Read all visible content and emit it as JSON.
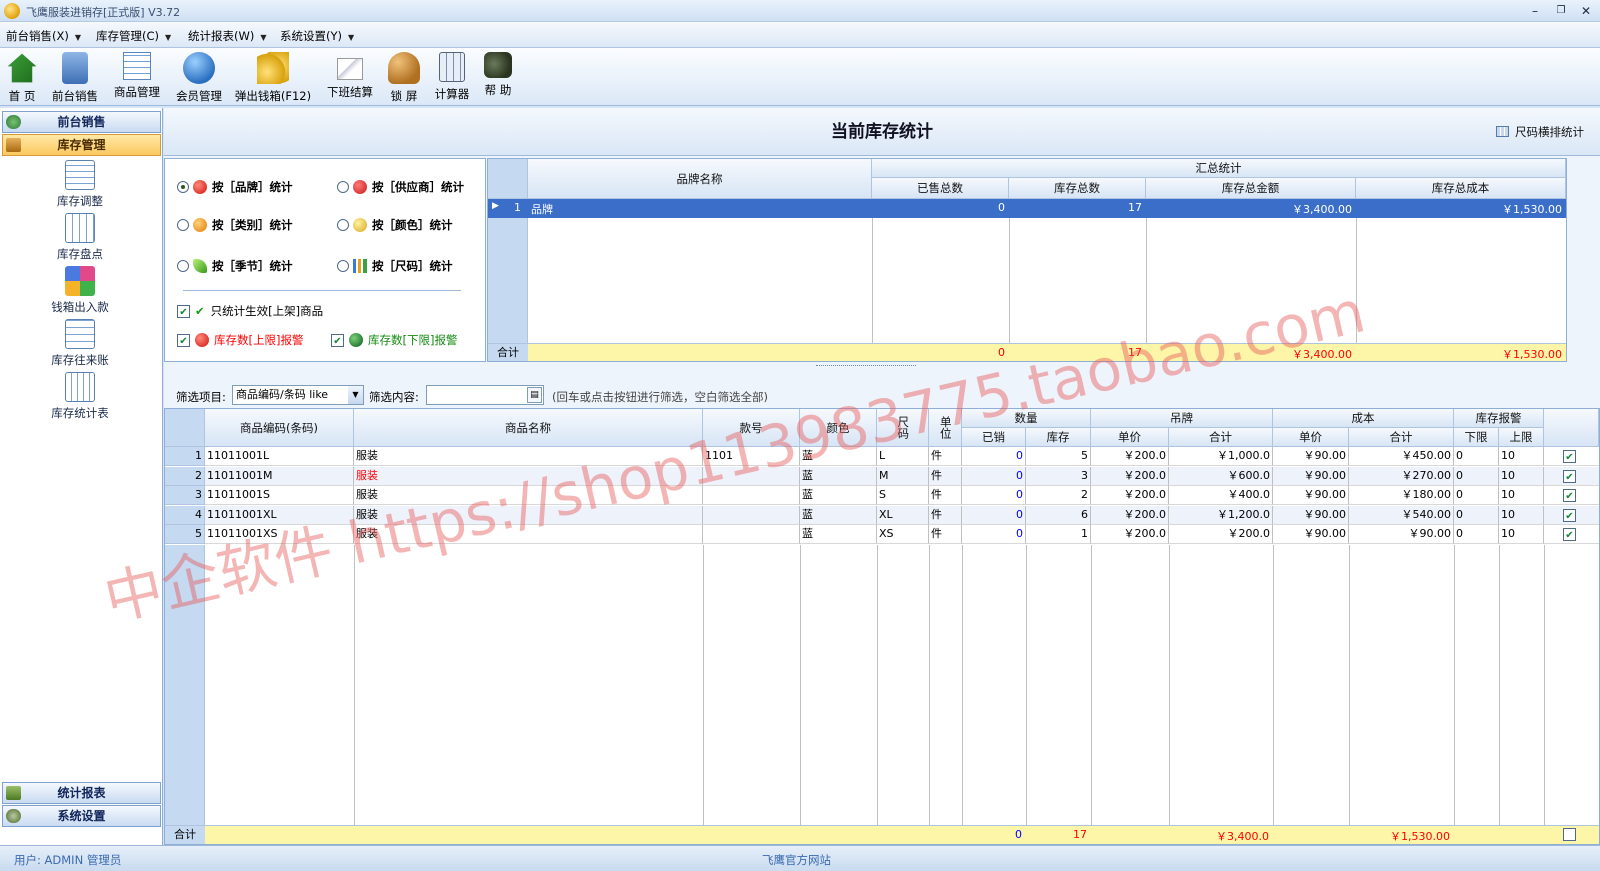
{
  "window": {
    "title": "飞鹰服装进销存[正式版] V3.72",
    "min": "–",
    "restore": "❐",
    "close": "✕"
  },
  "menu": [
    {
      "label": "前台销售(X)"
    },
    {
      "label": "库存管理(C)"
    },
    {
      "label": "统计报表(W)"
    },
    {
      "label": "系统设置(Y)"
    }
  ],
  "toolbar": [
    {
      "label": "首 页",
      "icon": "home-icon"
    },
    {
      "label": "前台销售",
      "icon": "sales-icon"
    },
    {
      "label": "商品管理",
      "icon": "product-icon"
    },
    {
      "label": "会员管理",
      "icon": "member-icon"
    },
    {
      "label": "弹出钱箱(F12)",
      "icon": "cashbox-icon"
    },
    {
      "label": "下班结算",
      "icon": "settle-icon"
    },
    {
      "label": "锁 屏",
      "icon": "lock-icon"
    },
    {
      "label": "计算器",
      "icon": "calculator-icon"
    },
    {
      "label": "帮 助",
      "icon": "help-icon"
    }
  ],
  "nav": {
    "sales_head": "前台销售",
    "stock_head": "库存管理",
    "items": [
      "库存调整",
      "库存盘点",
      "钱箱出入款",
      "库存往来账",
      "库存统计表"
    ],
    "report_head": "统计报表",
    "settings_head": "系统设置"
  },
  "page": {
    "title": "当前库存统计",
    "size_button": "尺码横排统计"
  },
  "options": {
    "by_brand": "按［品牌］统计",
    "by_supplier": "按［供应商］统计",
    "by_category": "按［类别］统计",
    "by_color": "按［颜色］统计",
    "by_season": "按［季节］统计",
    "by_size": "按［尺码］统计",
    "only_active": "只统计生效[上架]商品",
    "upper_alarm": "库存数[上限]报警",
    "lower_alarm": "库存数[下限]报警"
  },
  "summary": {
    "col_name": "品牌名称",
    "group": "汇总统计",
    "cols": [
      "已售总数",
      "库存总数",
      "库存总金额",
      "库存总成本"
    ],
    "rows": [
      {
        "no": "1",
        "name": "品牌",
        "sold": "0",
        "stock": "17",
        "amount": "￥3,400.00",
        "cost": "￥1,530.00"
      }
    ],
    "total_label": "合计",
    "total": {
      "sold": "0",
      "stock": "17",
      "amount": "￥3,400.00",
      "cost": "￥1,530.00"
    }
  },
  "filter": {
    "item_label": "筛选项目:",
    "item_value": "商品编码/条码 like",
    "content_label": "筛选内容:",
    "content_value": "",
    "hint": "(回车或点击按钮进行筛选，空白筛选全部)"
  },
  "detail": {
    "headers": {
      "code": "商品编码(条码)",
      "name": "商品名称",
      "style": "款号",
      "color": "颜色",
      "size": "尺码",
      "unit": "单位",
      "qty": "数量",
      "sold": "已销",
      "stock": "库存",
      "tag": "吊牌",
      "unit_price": "单价",
      "total": "合计",
      "cost": "成本",
      "cost_price": "单价",
      "cost_total": "合计",
      "alarm": "库存报警",
      "low": "下限",
      "high": "上限"
    },
    "rows": [
      {
        "no": "1",
        "code": "11011001L",
        "name": "服装",
        "style": "1101",
        "color": "蓝",
        "size": "L",
        "unit": "件",
        "sold": "0",
        "stock": "5",
        "price": "￥200.0",
        "total": "￥1,000.0",
        "cprice": "￥90.00",
        "ctotal": "￥450.00",
        "low": "0",
        "high": "10"
      },
      {
        "no": "2",
        "code": "11011001M",
        "name": "服装",
        "style": "",
        "color": "蓝",
        "size": "M",
        "unit": "件",
        "sold": "0",
        "stock": "3",
        "price": "￥200.0",
        "total": "￥600.0",
        "cprice": "￥90.00",
        "ctotal": "￥270.00",
        "low": "0",
        "high": "10"
      },
      {
        "no": "3",
        "code": "11011001S",
        "name": "服装",
        "style": "",
        "color": "蓝",
        "size": "S",
        "unit": "件",
        "sold": "0",
        "stock": "2",
        "price": "￥200.0",
        "total": "￥400.0",
        "cprice": "￥90.00",
        "ctotal": "￥180.00",
        "low": "0",
        "high": "10"
      },
      {
        "no": "4",
        "code": "11011001XL",
        "name": "服装",
        "style": "",
        "color": "蓝",
        "size": "XL",
        "unit": "件",
        "sold": "0",
        "stock": "6",
        "price": "￥200.0",
        "total": "￥1,200.0",
        "cprice": "￥90.00",
        "ctotal": "￥540.00",
        "low": "0",
        "high": "10"
      },
      {
        "no": "5",
        "code": "11011001XS",
        "name": "服装",
        "style": "",
        "color": "蓝",
        "size": "XS",
        "unit": "件",
        "sold": "0",
        "stock": "1",
        "price": "￥200.0",
        "total": "￥200.0",
        "cprice": "￥90.00",
        "ctotal": "￥90.00",
        "low": "0",
        "high": "10"
      }
    ],
    "total_label": "合计",
    "total": {
      "sold": "0",
      "stock": "17",
      "total": "￥3,400.0",
      "ctotal": "￥1,530.00"
    }
  },
  "status": {
    "user": "用户: ADMIN 管理员",
    "site": "飞鹰官方网站"
  },
  "watermark": {
    "text1": "中企软件 https://shop113983775.taobao.com"
  }
}
